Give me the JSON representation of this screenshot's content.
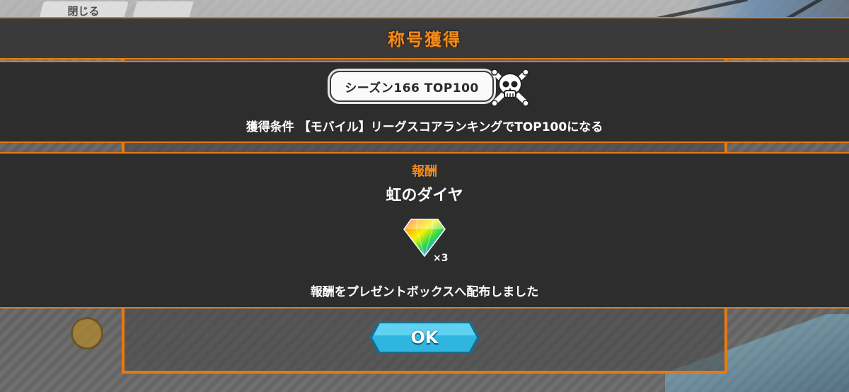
{
  "background": {
    "close_label": "閉じる"
  },
  "dialog": {
    "title": "称号獲得",
    "season_plate": "シーズン166 TOP100",
    "condition_text": "獲得条件 【モバイル】リーグスコアランキングでTOP100になる",
    "reward_label": "報酬",
    "reward_name": "虹のダイヤ",
    "reward_quantity": "×3",
    "distributed_text": "報酬をプレゼントボックスへ配布しました",
    "ok_label": "OK"
  },
  "icons": {
    "skull": "skull-crossbones-icon",
    "reward": "rainbow-diamond-icon"
  },
  "colors": {
    "accent_orange": "#e67a12",
    "title_orange": "#f08c1e",
    "band_dark": "#2d2d2d",
    "ok_button": "#2fb6e0"
  }
}
